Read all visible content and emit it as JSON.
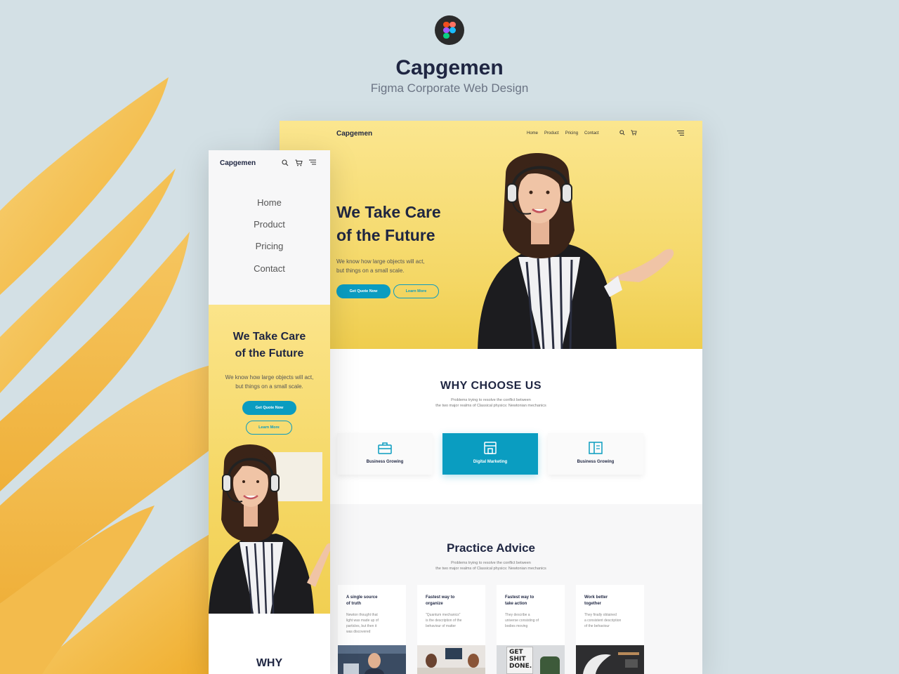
{
  "showcase": {
    "title": "Capgemen",
    "subtitle": "Figma Corporate Web Design"
  },
  "desktop": {
    "logo": "Capgemen",
    "nav": [
      "Home",
      "Product",
      "Pricing",
      "Contact"
    ],
    "hero": {
      "title_line1": "We Take Care",
      "title_line2": "of the Future",
      "text_line1": "We know how large objects will act,",
      "text_line2": "but things on a small scale.",
      "primary_button": "Get Quote Now",
      "secondary_button": "Learn More"
    },
    "why": {
      "title": "WHY CHOOSE US",
      "sub_line1": "Problems trying to resolve the conflict between",
      "sub_line2": "the two major realms of Classical physics: Newtonian mechanics",
      "cards": [
        {
          "label": "Business Growing",
          "icon": "briefcase-icon"
        },
        {
          "label": "Digital Marketing",
          "icon": "store-icon"
        },
        {
          "label": "Business Growing",
          "icon": "book-icon"
        }
      ]
    },
    "advice": {
      "title": "Practice Advice",
      "sub_line1": "Problems trying to resolve the conflict between",
      "sub_line2": "the two major realms of Classical physics: Newtonian mechanics",
      "items": [
        {
          "title_line1": "A single source",
          "title_line2": "of truth",
          "text": [
            "Newton thought that",
            "light was made up of",
            "particles, but then it",
            "was discovered"
          ]
        },
        {
          "title_line1": "Fastest way to",
          "title_line2": "organize",
          "text": [
            "\"Quantum mechanics\"",
            "is the description of the",
            "behaviour of matter"
          ]
        },
        {
          "title_line1": "Fastest way to",
          "title_line2": "take action",
          "text": [
            "They describe a",
            "universe consisting of",
            "bodies moving"
          ]
        },
        {
          "title_line1": "Work better",
          "title_line2": "together",
          "text": [
            "They finally obtained",
            "a consistent description",
            "of the behaviour"
          ]
        }
      ],
      "poster_text": [
        "GET",
        "SHIT",
        "DONE."
      ]
    }
  },
  "mobile": {
    "logo": "Capgemen",
    "menu": [
      "Home",
      "Product",
      "Pricing",
      "Contact"
    ],
    "hero": {
      "title_line1": "We Take Care",
      "title_line2": "of the Future",
      "text_line1": "We know how large objects will act,",
      "text_line2": "but things on a small scale.",
      "primary_button": "Get Quote Now",
      "secondary_button": "Learn More"
    },
    "why_title": "WHY"
  },
  "colors": {
    "accent": "#0b9cc0",
    "navy": "#1f2642",
    "hero_yellow": "#f5d764",
    "backdrop": "#d3e0e5",
    "petal": "#f2b640"
  }
}
